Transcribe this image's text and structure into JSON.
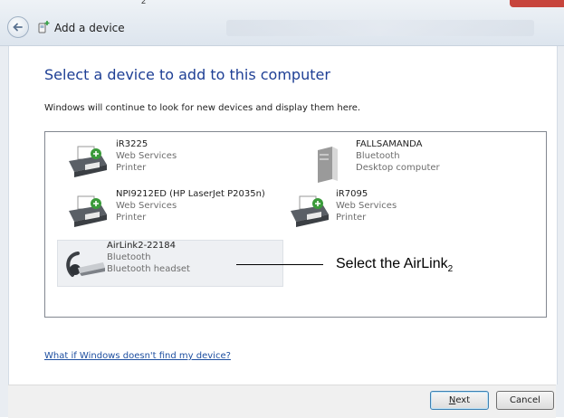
{
  "window": {
    "title": "Add a device",
    "top_glyph": "2",
    "icons": {
      "back": "back-arrow-icon",
      "title": "add-device-icon"
    }
  },
  "main": {
    "heading": "Select a device to add to this computer",
    "subtext": "Windows will continue to look for new devices and display them here.",
    "help_link": "What if Windows doesn't find my device?"
  },
  "devices": [
    {
      "name": "iR3225",
      "line1": "Web Services",
      "line2": "Printer",
      "icon": "printer-icon",
      "selected": false
    },
    {
      "name": "FALLSAMANDA",
      "line1": "Bluetooth",
      "line2": "Desktop computer",
      "icon": "desktop-computer-icon",
      "selected": false
    },
    {
      "name": "NPI9212ED (HP LaserJet P2035n)",
      "line1": "Web Services",
      "line2": "Printer",
      "icon": "printer-icon",
      "selected": false
    },
    {
      "name": "iR7095",
      "line1": "Web Services",
      "line2": "Printer",
      "icon": "printer-icon",
      "selected": false
    },
    {
      "name": "AirLink2-22184",
      "line1": "Bluetooth",
      "line2": "Bluetooth headset",
      "icon": "bluetooth-headset-icon",
      "selected": true
    }
  ],
  "annotation": {
    "text": "Select the AirLink",
    "subscript": "2"
  },
  "footer": {
    "next_label": "Next",
    "next_mnemonic": "N",
    "next_rest": "ext",
    "cancel_label": "Cancel"
  }
}
